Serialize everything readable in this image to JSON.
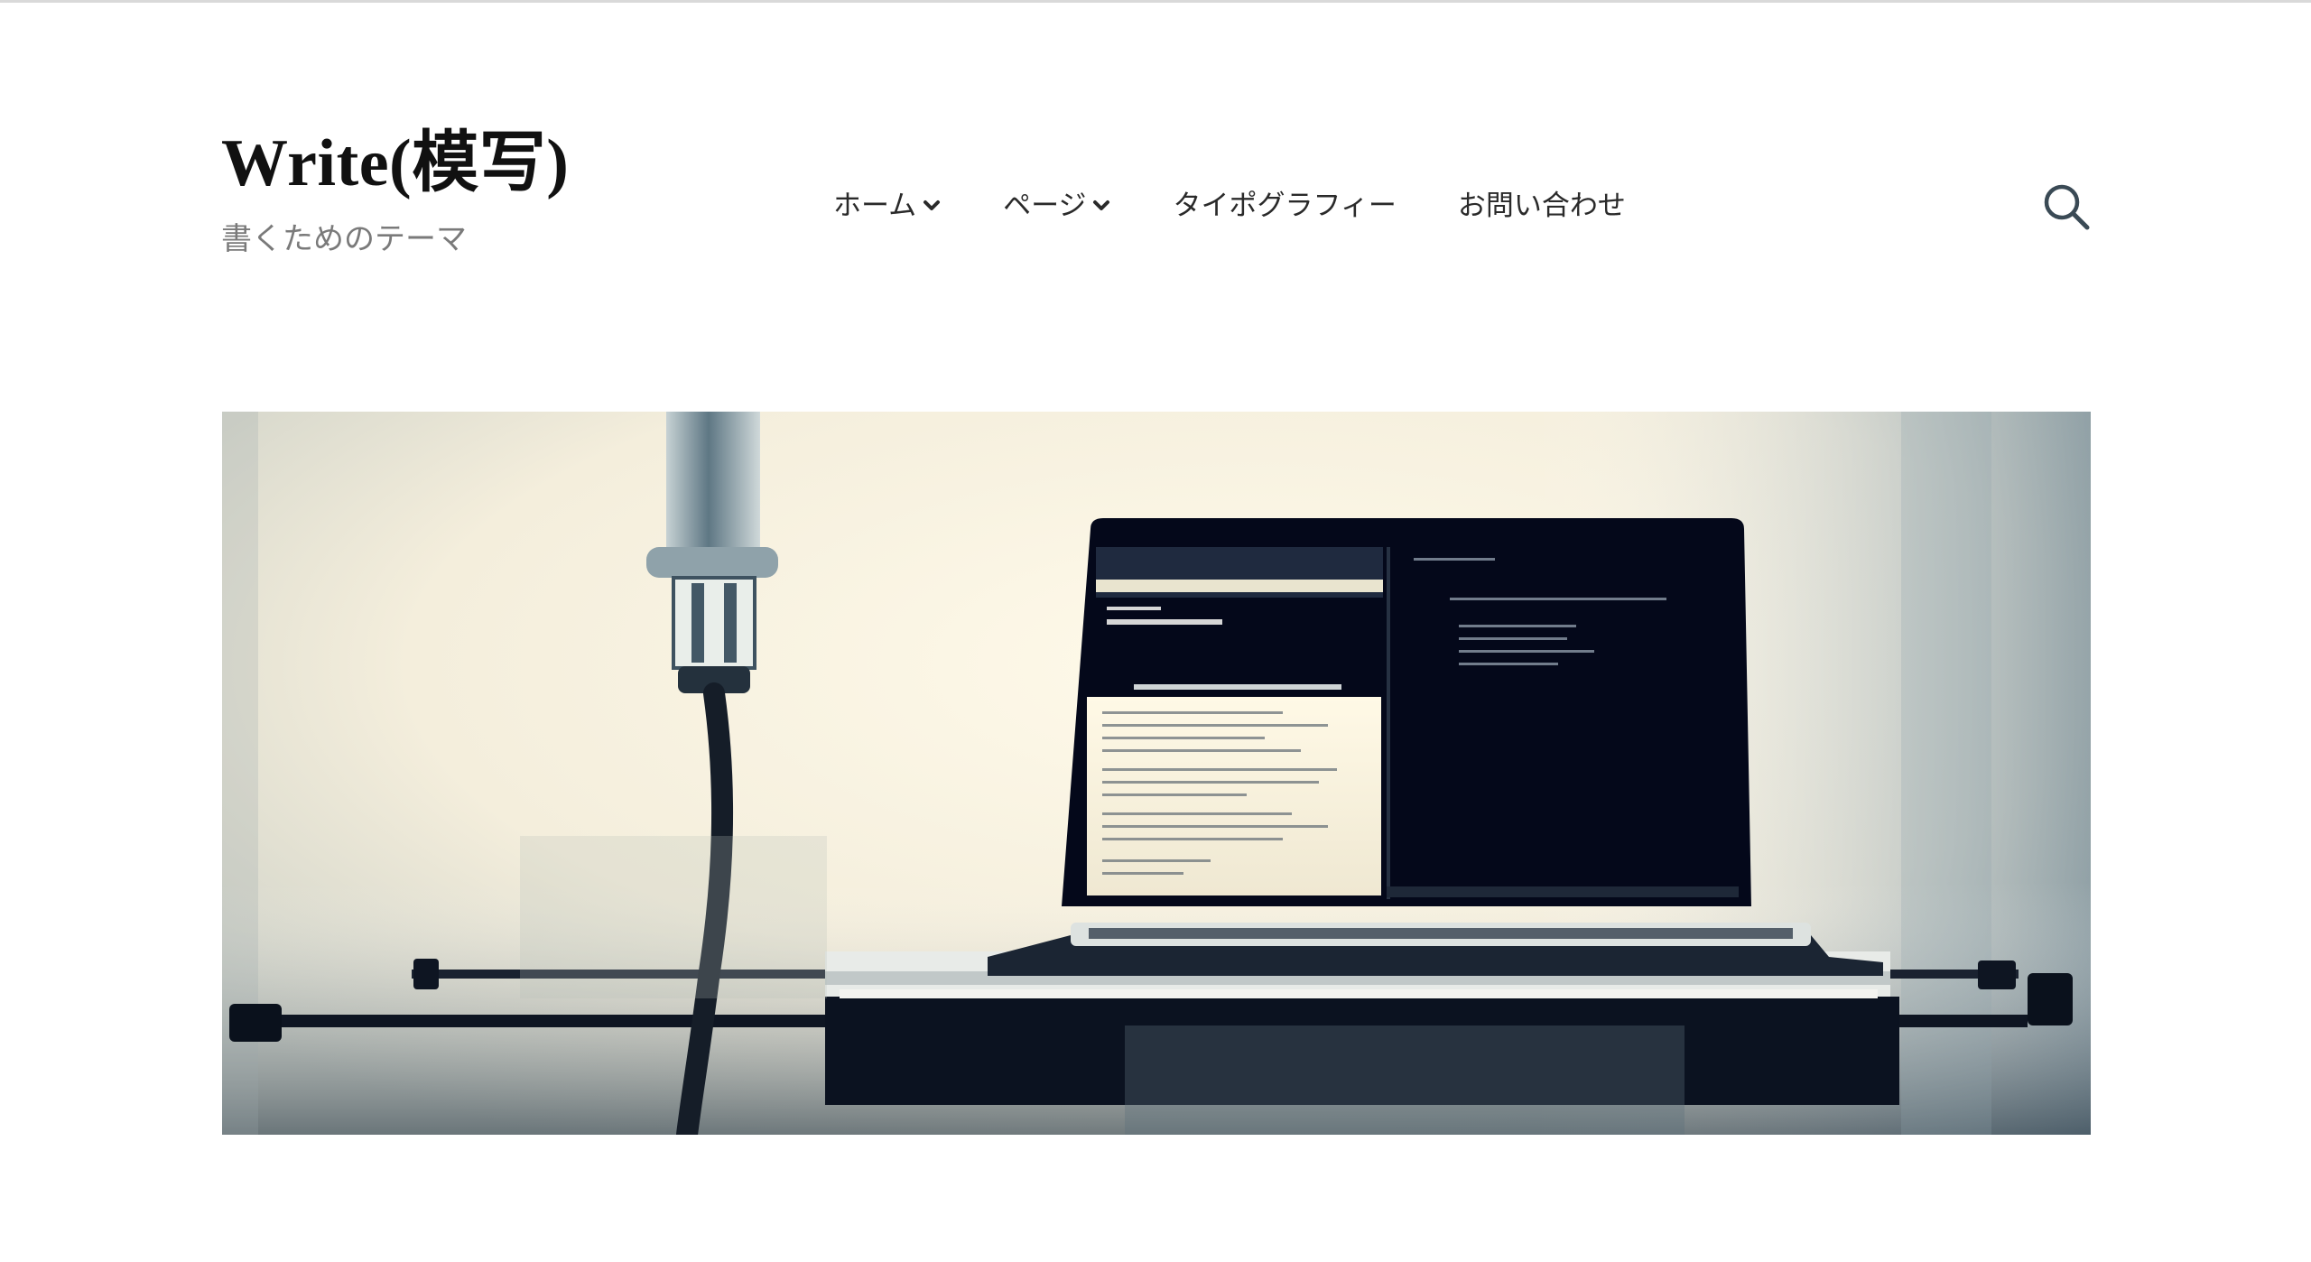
{
  "site": {
    "title": "Write(模写)",
    "tagline": "書くためのテーマ"
  },
  "nav": {
    "items": [
      {
        "label": "ホーム",
        "has_dropdown": true
      },
      {
        "label": "ページ",
        "has_dropdown": true
      },
      {
        "label": "タイポグラフィー",
        "has_dropdown": false
      },
      {
        "label": "お問い合わせ",
        "has_dropdown": false
      }
    ]
  },
  "header_icons": {
    "search": "search-icon",
    "dropdown": "chevron-down-icon"
  },
  "colors": {
    "text": "#111111",
    "tagline": "#7a7a7a",
    "nav_text": "#2a2a2a",
    "icon": "#3a4a55"
  }
}
